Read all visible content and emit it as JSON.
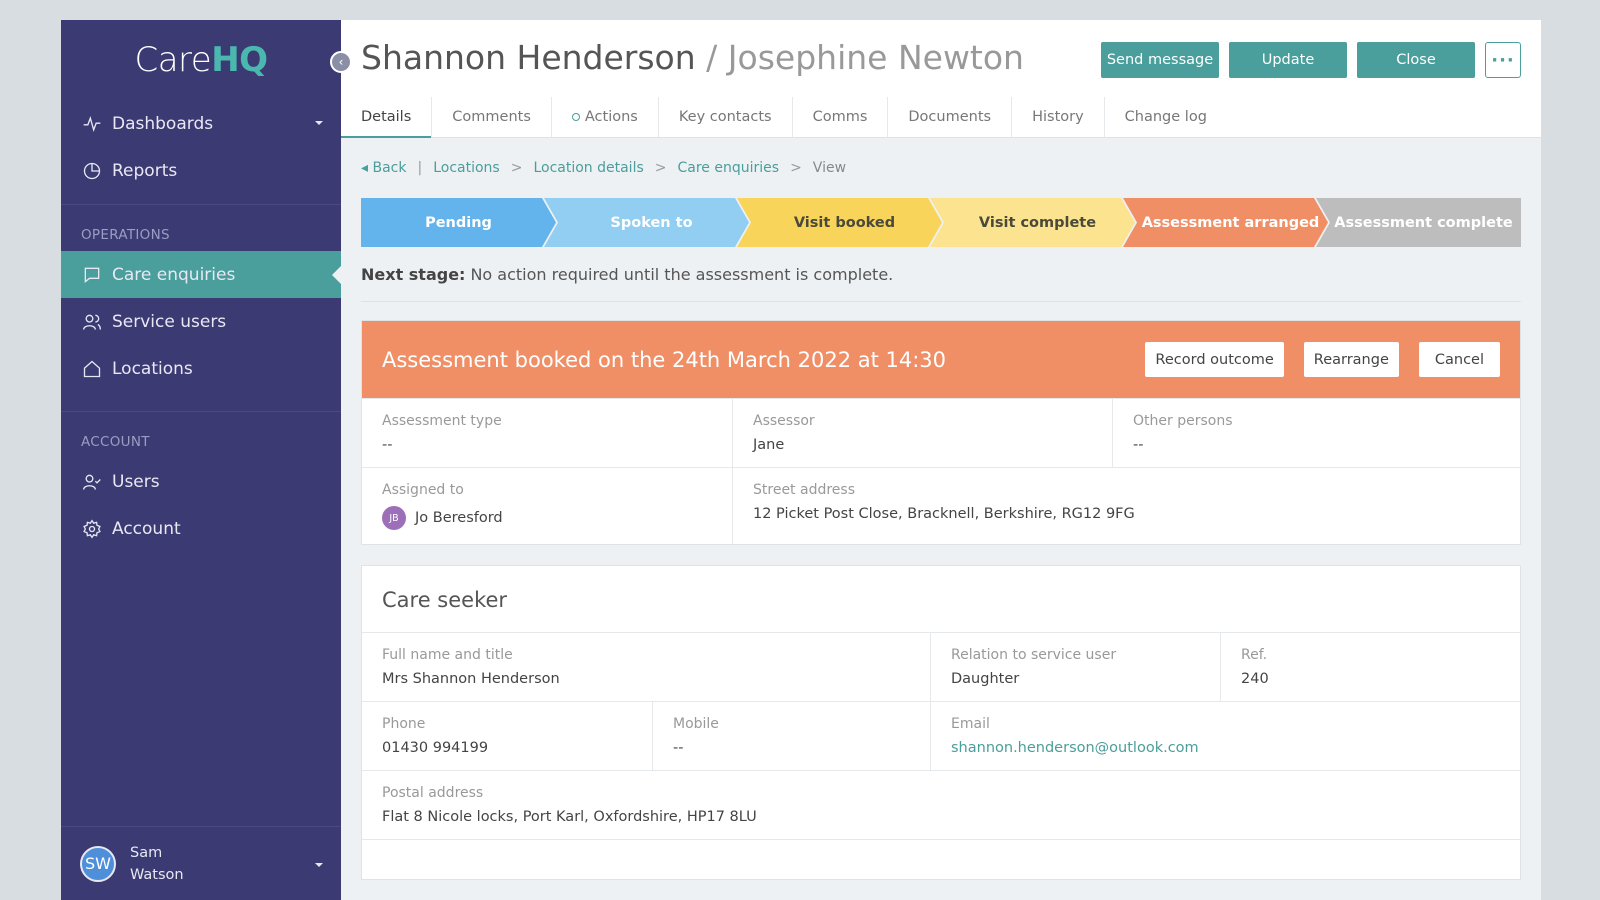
{
  "logo": {
    "care": "Care",
    "hq": "HQ"
  },
  "sidebar": {
    "nav_top": [
      {
        "label": "Dashboards",
        "icon": "activity-icon",
        "has_caret": true
      },
      {
        "label": "Reports",
        "icon": "pie-chart-icon"
      }
    ],
    "operations_label": "OPERATIONS",
    "operations": [
      {
        "label": "Care enquiries",
        "icon": "chat-icon",
        "active": true
      },
      {
        "label": "Service users",
        "icon": "users-icon"
      },
      {
        "label": "Locations",
        "icon": "home-icon"
      }
    ],
    "account_label": "ACCOUNT",
    "account": [
      {
        "label": "Users",
        "icon": "user-check-icon"
      },
      {
        "label": "Account",
        "icon": "gear-icon"
      }
    ],
    "user": {
      "initials": "SW",
      "first_name": "Sam",
      "last_name": "Watson"
    }
  },
  "header": {
    "title_primary": "Shannon Henderson",
    "title_sep": "/",
    "title_secondary": "Josephine Newton",
    "buttons": {
      "send_message": "Send message",
      "update": "Update",
      "close": "Close",
      "more": "···"
    }
  },
  "tabs": [
    "Details",
    "Comments",
    "Actions",
    "Key contacts",
    "Comms",
    "Documents",
    "History",
    "Change log"
  ],
  "breadcrumb": {
    "back": "Back",
    "items": [
      "Locations",
      "Location details",
      "Care enquiries"
    ],
    "current": "View",
    "sep": ">",
    "bar": "|"
  },
  "stages": [
    {
      "label": "Pending",
      "color": "#63b4ec"
    },
    {
      "label": "Spoken to",
      "color": "#92cdf2"
    },
    {
      "label": "Visit booked",
      "color": "#f9d45b",
      "dark": true
    },
    {
      "label": "Visit complete",
      "color": "#fbe38f",
      "dark": true
    },
    {
      "label": "Assessment arranged",
      "color": "#f08f66"
    },
    {
      "label": "Assessment complete",
      "color": "#bdbdbd"
    }
  ],
  "next_stage": {
    "label": "Next stage:",
    "text": "No action required until the assessment is complete."
  },
  "assessment": {
    "banner_title": "Assessment booked on the 24th March 2022 at 14:30",
    "buttons": {
      "record_outcome": "Record outcome",
      "rearrange": "Rearrange",
      "cancel": "Cancel"
    },
    "type_label": "Assessment type",
    "type_value": "--",
    "assessor_label": "Assessor",
    "assessor_value": "Jane",
    "other_label": "Other persons",
    "other_value": "--",
    "assigned_label": "Assigned to",
    "assigned_initials": "JB",
    "assigned_value": "Jo Beresford",
    "street_label": "Street address",
    "street_value": "12 Picket Post Close, Bracknell, Berkshire, RG12 9FG"
  },
  "care_seeker": {
    "title": "Care seeker",
    "fullname_label": "Full name and title",
    "fullname_value": "Mrs Shannon Henderson",
    "relation_label": "Relation to service user",
    "relation_value": "Daughter",
    "ref_label": "Ref.",
    "ref_value": "240",
    "phone_label": "Phone",
    "phone_value": "01430 994199",
    "mobile_label": "Mobile",
    "mobile_value": "--",
    "email_label": "Email",
    "email_value": "shannon.henderson@outlook.com",
    "postal_label": "Postal address",
    "postal_value": "Flat 8 Nicole locks, Port Karl, Oxfordshire, HP17 8LU"
  },
  "colors": {
    "sidebar": "#3c3a72",
    "accent": "#4a9e9b",
    "banner": "#f08f66"
  }
}
